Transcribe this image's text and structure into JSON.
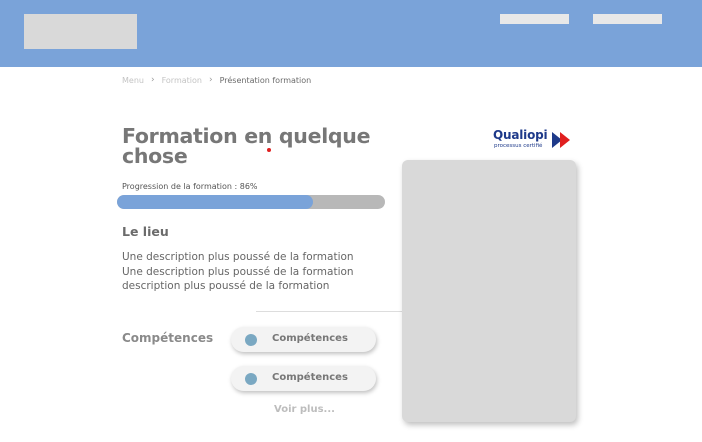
{
  "header": {
    "logo_placeholder": "",
    "nav_links": [
      "",
      ""
    ]
  },
  "breadcrumb": {
    "items": [
      "Menu",
      "Formation",
      "Présentation formation"
    ]
  },
  "course": {
    "title": "Formation en quelque chose",
    "progress_label": "Progression de la formation : 86%",
    "progress_fraction": 0.73
  },
  "certification": {
    "name": "Qualiopi",
    "subtitle": "processus certifié",
    "colors": {
      "text": "#1e3a8a",
      "blue": "#1e3a8a",
      "red": "#e02020"
    }
  },
  "location": {
    "heading": "Le lieu",
    "description_lines": [
      "Une description plus poussé de la formation",
      "Une description plus poussé de la formation",
      "description plus poussé de la formation"
    ]
  },
  "skills": {
    "heading": "Compétences",
    "items": [
      "Compétences",
      "Compétences"
    ],
    "more_label": "Voir plus..."
  },
  "colors": {
    "header_bg": "#7aa3d9",
    "progress_fill": "#7aa3d9",
    "progress_track": "#b8b8b8",
    "skill_dot": "#7aa8c2",
    "placeholder": "#d9d9d9"
  }
}
